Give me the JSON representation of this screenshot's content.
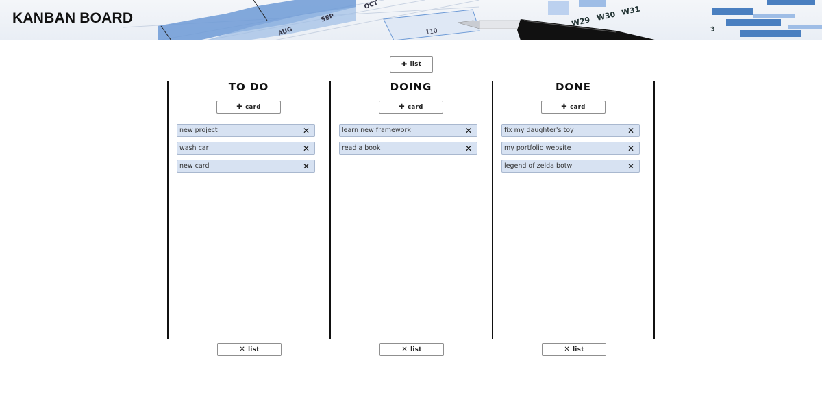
{
  "header": {
    "title": "KANBAN BOARD",
    "background_text": [
      "AUG",
      "SEP",
      "OCT",
      "110",
      "W29",
      "W30",
      "W31",
      "3"
    ]
  },
  "toolbar": {
    "add_list_icon": "plus-icon",
    "add_list_label": "list"
  },
  "lists": [
    {
      "title": "TO DO",
      "add_card_label": "card",
      "remove_label": "list",
      "cards": [
        "new project",
        "wash car",
        "new card"
      ]
    },
    {
      "title": "DOING",
      "add_card_label": "card",
      "remove_label": "list",
      "cards": [
        "learn new framework",
        "read a book"
      ]
    },
    {
      "title": "DONE",
      "add_card_label": "card",
      "remove_label": "list",
      "cards": [
        "fix my daughter's toy",
        "my portfolio website",
        "legend of zelda botw"
      ]
    }
  ],
  "colors": {
    "card_bg": "#d7e2f2",
    "card_border": "#a9b8cf",
    "divider": "#111111",
    "chart_blue": "#4a7fc0"
  }
}
